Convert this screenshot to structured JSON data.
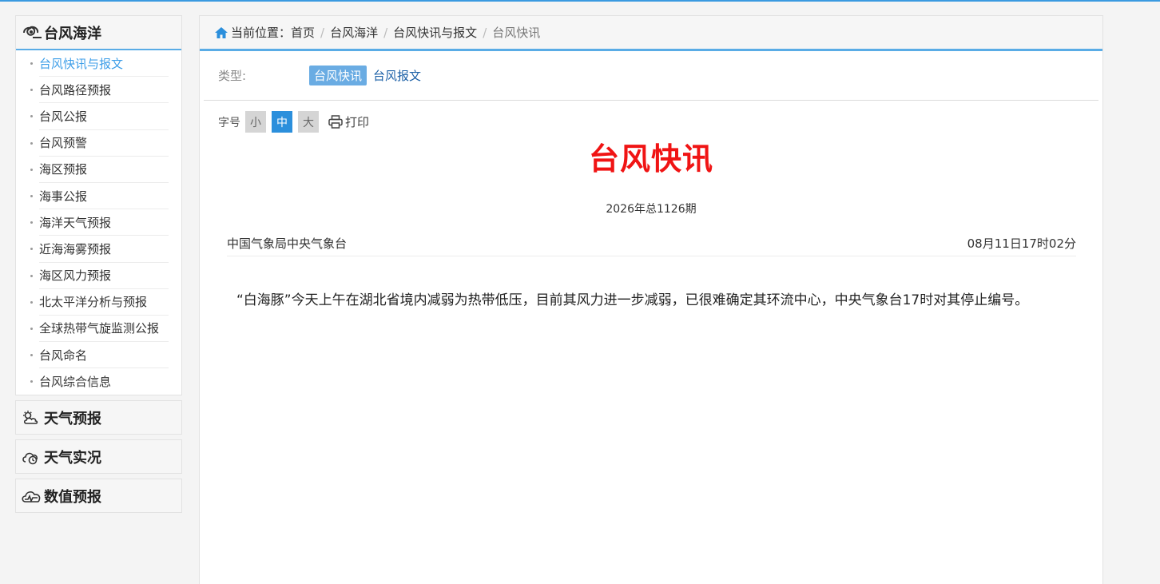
{
  "sidebar": {
    "section_title": "台风海洋",
    "items": [
      {
        "label": "台风快讯与报文",
        "active": true
      },
      {
        "label": "台风路径预报"
      },
      {
        "label": "台风公报"
      },
      {
        "label": "台风预警"
      },
      {
        "label": "海区预报"
      },
      {
        "label": "海事公报"
      },
      {
        "label": "海洋天气预报"
      },
      {
        "label": "近海海雾预报"
      },
      {
        "label": "海区风力预报"
      },
      {
        "label": "北太平洋分析与预报"
      },
      {
        "label": "全球热带气旋监测公报"
      },
      {
        "label": "台风命名"
      },
      {
        "label": "台风综合信息"
      }
    ],
    "collapsed": [
      {
        "label": "天气预报",
        "icon": "cloud-sun-icon"
      },
      {
        "label": "天气实况",
        "icon": "cloud-clock-icon"
      },
      {
        "label": "数值预报",
        "icon": "cloud-wave-icon"
      }
    ]
  },
  "breadcrumb": {
    "prefix": "当前位置：",
    "items": [
      "首页",
      "台风海洋",
      "台风快讯与报文"
    ],
    "current": "台风快讯"
  },
  "type_filter": {
    "label": "类型:",
    "active": "台风快讯",
    "other": "台风报文"
  },
  "font_size": {
    "label": "字号",
    "small": "小",
    "medium": "中",
    "large": "大",
    "selected": "中",
    "print": "打印"
  },
  "article": {
    "title": "台风快讯",
    "issue": "2026年总1126期",
    "source": "中国气象局中央气象台",
    "time": "08月11日17时02分",
    "body": "“白海豚”今天上午在湖北省境内减弱为热带低压，目前其风力进一步减弱，已很难确定其环流中心，中央气象台17时对其停止编号。"
  },
  "colors": {
    "accent": "#5aace6",
    "title_red": "#f01414",
    "active_link": "#3d9ee8"
  }
}
